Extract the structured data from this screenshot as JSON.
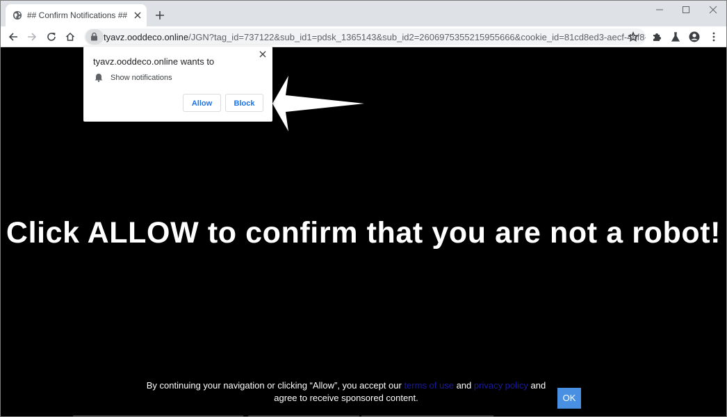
{
  "browser": {
    "tab": {
      "title": "## Confirm Notifications ##",
      "favicon": "globe-icon"
    },
    "new_tab_icon": "plus-icon",
    "window_controls": [
      "minimize-icon",
      "maximize-icon",
      "close-icon"
    ],
    "toolbar_icons": [
      "back-icon",
      "forward-icon",
      "reload-icon",
      "home-icon",
      "star-icon",
      "extensions-icon",
      "labs-icon",
      "profile-icon",
      "menu-icon"
    ],
    "address": {
      "host": "tyavz.ooddeco.online",
      "path": "/JGN?tag_id=737122&sub_id1=pdsk_1365143&sub_id2=2606975355215955666&cookie_id=81cd8ed3-aecf-4bf8-bfe1-..."
    }
  },
  "popup": {
    "title": "tyavz.ooddeco.online wants to",
    "permission": "Show notifications",
    "allow_label": "Allow",
    "block_label": "Block"
  },
  "page": {
    "headline": "Click ALLOW to confirm that you are not a robot!",
    "consent": {
      "prefix": "By continuing your navigation or clicking “Allow”, you accept our ",
      "terms_link": "terms of use",
      "mid": " and ",
      "privacy_link": "privacy policy",
      "suffix": " and agree to receive sponsored content."
    },
    "ok_label": "OK"
  },
  "colors": {
    "page_bg": "#000000",
    "headline": "#ffffff",
    "link": "#1a1a9a",
    "ok_button": "#4a90e2",
    "popup_button_text": "#1a73e8"
  }
}
